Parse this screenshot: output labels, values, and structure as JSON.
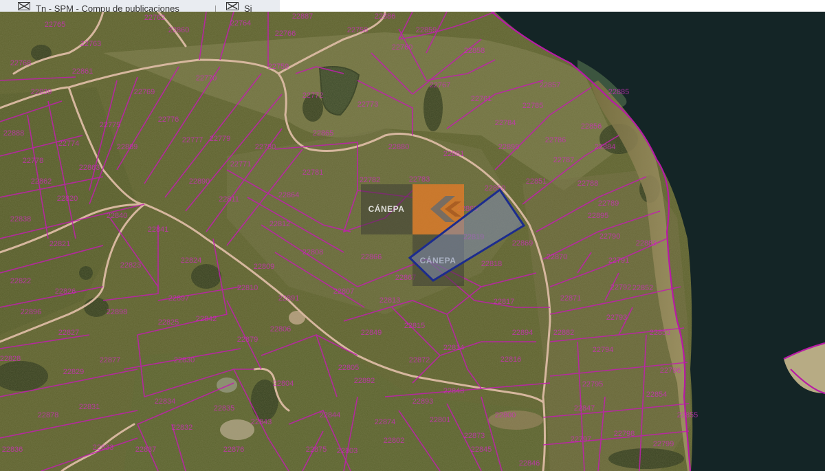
{
  "tabs": [
    {
      "label": "Tn - SPM - Compu de publicaciones"
    },
    {
      "label": "Si"
    }
  ],
  "colors": {
    "parcel_line": "#c21eb0",
    "road": "#d6b79e",
    "water": "#142526",
    "highlight": "#1c2c8e"
  },
  "watermark": {
    "text": "CÁNEPA"
  },
  "lots": [
    {
      "label": "22765"
    },
    {
      "label": "22763"
    },
    {
      "label": "22762"
    },
    {
      "label": "22764"
    },
    {
      "label": "22766"
    },
    {
      "label": "22759"
    },
    {
      "label": "22758"
    },
    {
      "label": "22760"
    },
    {
      "label": "22767"
    },
    {
      "label": "22761"
    },
    {
      "label": "22768"
    },
    {
      "label": "22769"
    },
    {
      "label": "22770"
    },
    {
      "label": "22771"
    },
    {
      "label": "22772"
    },
    {
      "label": "22773"
    },
    {
      "label": "22774"
    },
    {
      "label": "22775"
    },
    {
      "label": "22776"
    },
    {
      "label": "22777"
    },
    {
      "label": "22778"
    },
    {
      "label": "22779"
    },
    {
      "label": "22780"
    },
    {
      "label": "22781"
    },
    {
      "label": "22782"
    },
    {
      "label": "22783"
    },
    {
      "label": "22784"
    },
    {
      "label": "22785"
    },
    {
      "label": "22786"
    },
    {
      "label": "22787"
    },
    {
      "label": "22788"
    },
    {
      "label": "22789"
    },
    {
      "label": "22790"
    },
    {
      "label": "22791"
    },
    {
      "label": "22792"
    },
    {
      "label": "22793"
    },
    {
      "label": "22794"
    },
    {
      "label": "22795"
    },
    {
      "label": "22796"
    },
    {
      "label": "22797"
    },
    {
      "label": "22798"
    },
    {
      "label": "22799"
    },
    {
      "label": "22800"
    },
    {
      "label": "22801"
    },
    {
      "label": "22802"
    },
    {
      "label": "22803"
    },
    {
      "label": "22804"
    },
    {
      "label": "22805"
    },
    {
      "label": "22806"
    },
    {
      "label": "22807"
    },
    {
      "label": "22808"
    },
    {
      "label": "22809"
    },
    {
      "label": "22810"
    },
    {
      "label": "22811"
    },
    {
      "label": "22812"
    },
    {
      "label": "22813"
    },
    {
      "label": "22814"
    },
    {
      "label": "22815"
    },
    {
      "label": "22816"
    },
    {
      "label": "22817"
    },
    {
      "label": "22818"
    },
    {
      "label": "22819"
    },
    {
      "label": "22820"
    },
    {
      "label": "22821"
    },
    {
      "label": "22822"
    },
    {
      "label": "22823"
    },
    {
      "label": "22824"
    },
    {
      "label": "22825"
    },
    {
      "label": "22826"
    },
    {
      "label": "22827"
    },
    {
      "label": "22828"
    },
    {
      "label": "22829"
    },
    {
      "label": "22830"
    },
    {
      "label": "22831"
    },
    {
      "label": "22832"
    },
    {
      "label": "22833"
    },
    {
      "label": "22834"
    },
    {
      "label": "22835"
    },
    {
      "label": "22836"
    },
    {
      "label": "22837"
    },
    {
      "label": "22838"
    },
    {
      "label": "22839"
    },
    {
      "label": "22840"
    },
    {
      "label": "22841"
    },
    {
      "label": "22842"
    },
    {
      "label": "22843"
    },
    {
      "label": "22844"
    },
    {
      "label": "22845"
    },
    {
      "label": "22846"
    },
    {
      "label": "22847"
    },
    {
      "label": "22848"
    },
    {
      "label": "22849"
    },
    {
      "label": "22850"
    },
    {
      "label": "22851"
    },
    {
      "label": "22852"
    },
    {
      "label": "22853"
    },
    {
      "label": "22854"
    },
    {
      "label": "22855"
    },
    {
      "label": "22856"
    },
    {
      "label": "22857"
    },
    {
      "label": "22858"
    },
    {
      "label": "22859"
    },
    {
      "label": "22860"
    },
    {
      "label": "22861"
    },
    {
      "label": "22862"
    },
    {
      "label": "22863"
    },
    {
      "label": "22864"
    },
    {
      "label": "22865"
    },
    {
      "label": "22866"
    },
    {
      "label": "22867"
    },
    {
      "label": "22868"
    },
    {
      "label": "22869"
    },
    {
      "label": "22870"
    },
    {
      "label": "22871"
    },
    {
      "label": "22872"
    },
    {
      "label": "22873"
    },
    {
      "label": "22874"
    },
    {
      "label": "22875"
    },
    {
      "label": "22876"
    },
    {
      "label": "22877"
    },
    {
      "label": "22878"
    },
    {
      "label": "22879"
    },
    {
      "label": "22880"
    },
    {
      "label": "22881"
    },
    {
      "label": "22882"
    },
    {
      "label": "22883"
    },
    {
      "label": "22884"
    },
    {
      "label": "22885"
    },
    {
      "label": "22886"
    },
    {
      "label": "22887"
    },
    {
      "label": "22888"
    },
    {
      "label": "22889"
    },
    {
      "label": "22890"
    },
    {
      "label": "22891"
    },
    {
      "label": "22892"
    },
    {
      "label": "22893"
    },
    {
      "label": "22894"
    },
    {
      "label": "22895"
    },
    {
      "label": "22896"
    },
    {
      "label": "22897"
    },
    {
      "label": "22898"
    },
    {
      "label": "22899"
    }
  ]
}
